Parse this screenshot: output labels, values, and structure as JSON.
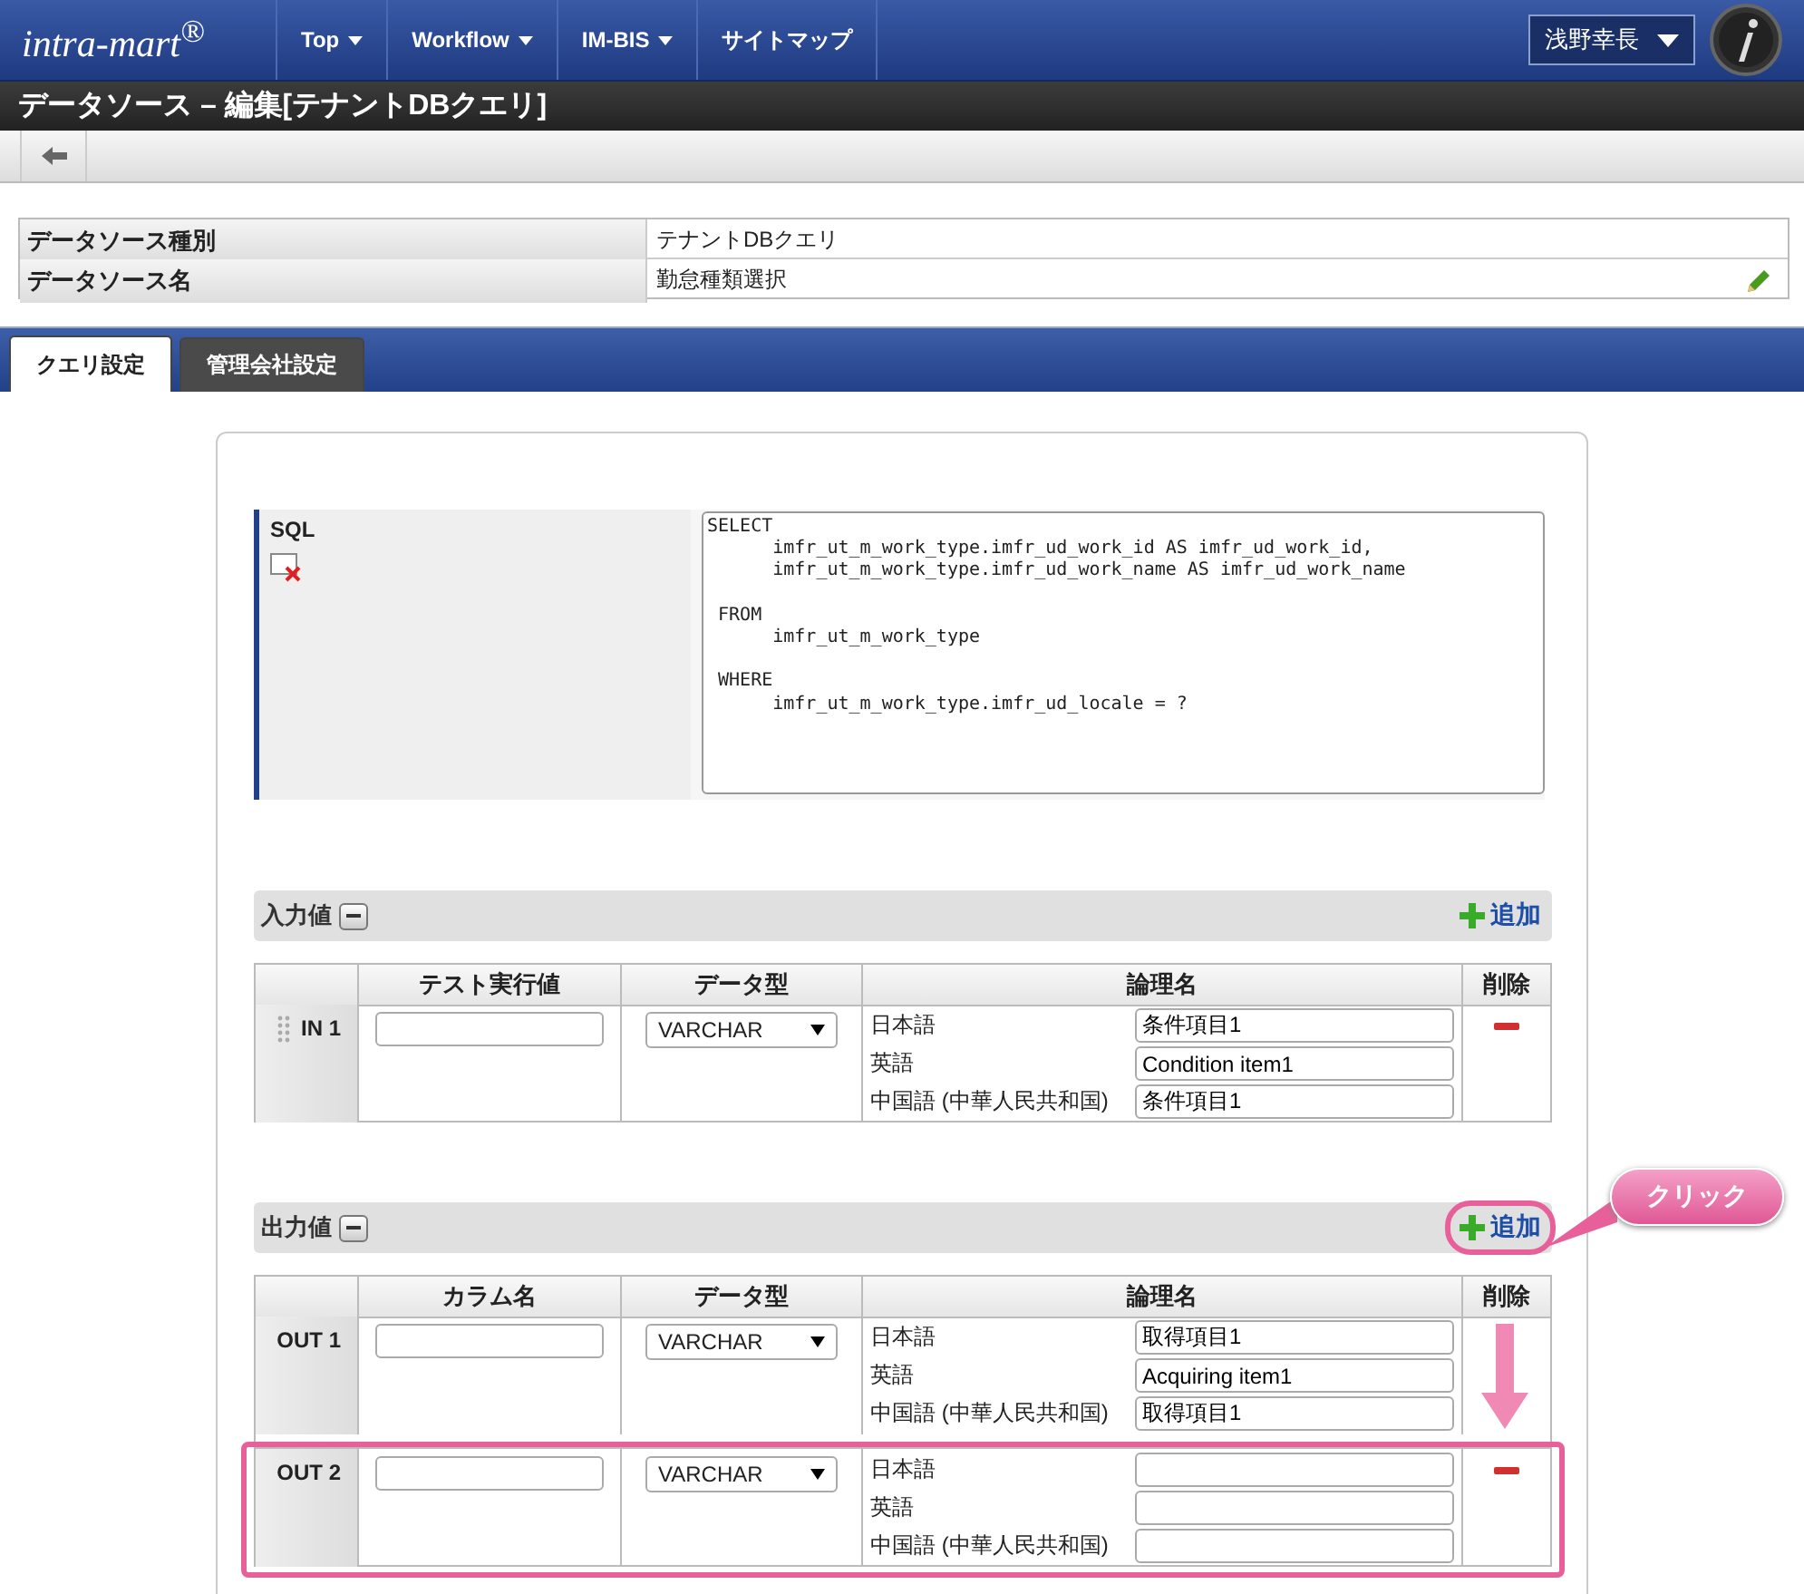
{
  "header": {
    "logo": "intra-mart$^{®}$",
    "nav": [
      {
        "label": "Top",
        "dropdown": true
      },
      {
        "label": "Workflow",
        "dropdown": true
      },
      {
        "label": "IM-BIS",
        "dropdown": true
      },
      {
        "label": "サイトマップ",
        "dropdown": false
      }
    ],
    "user": "浅野幸長"
  },
  "title": "データソース – 編集[テナントDBクエリ]",
  "info": [
    {
      "label": "データソース種別",
      "value": "テナントDBクエリ",
      "editable": false
    },
    {
      "label": "データソース名",
      "value": "勤怠種類選択",
      "editable": true
    }
  ],
  "tabs": [
    {
      "label": "クエリ設定",
      "selected": true
    },
    {
      "label": "管理会社設定",
      "selected": false
    }
  ],
  "sql": {
    "label": "SQL",
    "text": "SELECT\n      imfr_ut_m_work_type.imfr_ud_work_id AS imfr_ud_work_id,\n      imfr_ut_m_work_type.imfr_ud_work_name AS imfr_ud_work_name\n\n FROM\n      imfr_ut_m_work_type\n\n WHERE\n      imfr_ut_m_work_type.imfr_ud_locale = ?"
  },
  "sections": [
    {
      "title": "入力値",
      "add": "追加",
      "add_highlighted": false,
      "columns": [
        "テスト実行値",
        "データ型",
        "論理名",
        "削除"
      ],
      "rows": [
        {
          "label": "IN 1",
          "draggable": true,
          "type": "VARCHAR",
          "delete": true,
          "highlighted": false,
          "names": [
            {
              "lang": "日本語",
              "value": "条件項目1"
            },
            {
              "lang": "英語",
              "value": "Condition item1"
            },
            {
              "lang": "中国語 (中華人民共和国)",
              "value": "条件項目1"
            }
          ]
        }
      ]
    },
    {
      "title": "出力値",
      "add": "追加",
      "add_highlighted": true,
      "columns": [
        "カラム名",
        "データ型",
        "論理名",
        "削除"
      ],
      "rows": [
        {
          "label": "OUT 1",
          "draggable": false,
          "type": "VARCHAR",
          "delete": false,
          "highlighted": false,
          "names": [
            {
              "lang": "日本語",
              "value": "取得項目1"
            },
            {
              "lang": "英語",
              "value": "Acquiring item1"
            },
            {
              "lang": "中国語 (中華人民共和国)",
              "value": "取得項目1"
            }
          ]
        },
        {
          "label": "OUT 2",
          "draggable": false,
          "type": "VARCHAR",
          "delete": true,
          "highlighted": true,
          "names": [
            {
              "lang": "日本語"
            },
            {
              "lang": "英語"
            },
            {
              "lang": "中国語 (中華人民共和国)"
            }
          ]
        }
      ]
    }
  ],
  "callout": {
    "text": "クリック"
  }
}
